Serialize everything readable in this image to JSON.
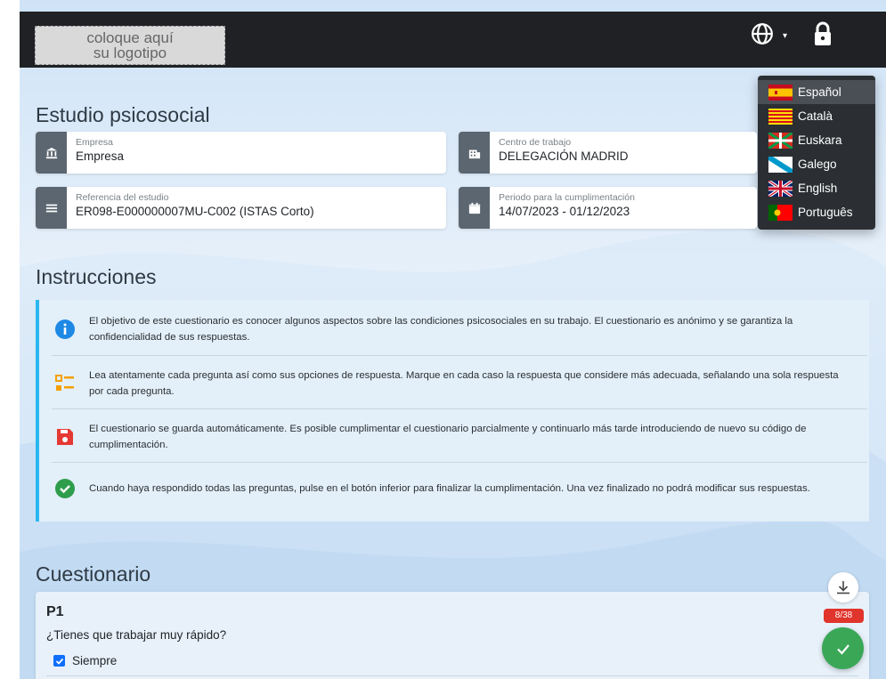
{
  "header": {
    "logo_line1": "coloque aquí",
    "logo_line2": "su logotipo"
  },
  "languages": [
    {
      "label": "Español",
      "active": true
    },
    {
      "label": "Català",
      "active": false
    },
    {
      "label": "Euskara",
      "active": false
    },
    {
      "label": "Galego",
      "active": false
    },
    {
      "label": "English",
      "active": false
    },
    {
      "label": "Português",
      "active": false
    }
  ],
  "study": {
    "title": "Estudio psicosocial",
    "empresa_label": "Empresa",
    "empresa_value": "Empresa",
    "centro_label": "Centro de trabajo",
    "centro_value": "DELEGACIÓN MADRID",
    "referencia_label": "Referencia del estudio",
    "referencia_value": "ER098-E000000007MU-C002 (ISTAS Corto)",
    "periodo_label": "Periodo para la cumplimentación",
    "periodo_value": "14/07/2023 - 01/12/2023"
  },
  "instructions": {
    "title": "Instrucciones",
    "items": [
      {
        "icon": "info-icon",
        "text": "El objetivo de este cuestionario es conocer algunos aspectos sobre las condiciones psicosociales en su trabajo. El cuestionario es anónimo y se garantiza la confidencialidad de sus respuestas."
      },
      {
        "icon": "checklist-icon",
        "text": "Lea atentamente cada pregunta así como sus opciones de respuesta. Marque en cada caso la respuesta que considere más adecuada, señalando una sola respuesta por cada pregunta."
      },
      {
        "icon": "save-icon",
        "text": "El cuestionario se guarda automáticamente. Es posible cumplimentar el cuestionario parcialmente y continuarlo más tarde introduciendo de nuevo su código de cumplimentación."
      },
      {
        "icon": "check-circle-icon",
        "text": "Cuando haya respondido todas las preguntas, pulse en el botón inferior para finalizar la cumplimentación. Una vez finalizado no podrá modificar sus respuestas."
      }
    ]
  },
  "questionnaire": {
    "title": "Cuestionario",
    "question_id": "P1",
    "question_text": "¿Tienes que trabajar muy rápido?",
    "option_label": "Siempre",
    "progress": "8/38"
  },
  "colors": {
    "header_bg": "#1f2124",
    "accent_info": "#2ab7f0",
    "done_green": "#3aa757",
    "badge_red": "#e0342c"
  }
}
